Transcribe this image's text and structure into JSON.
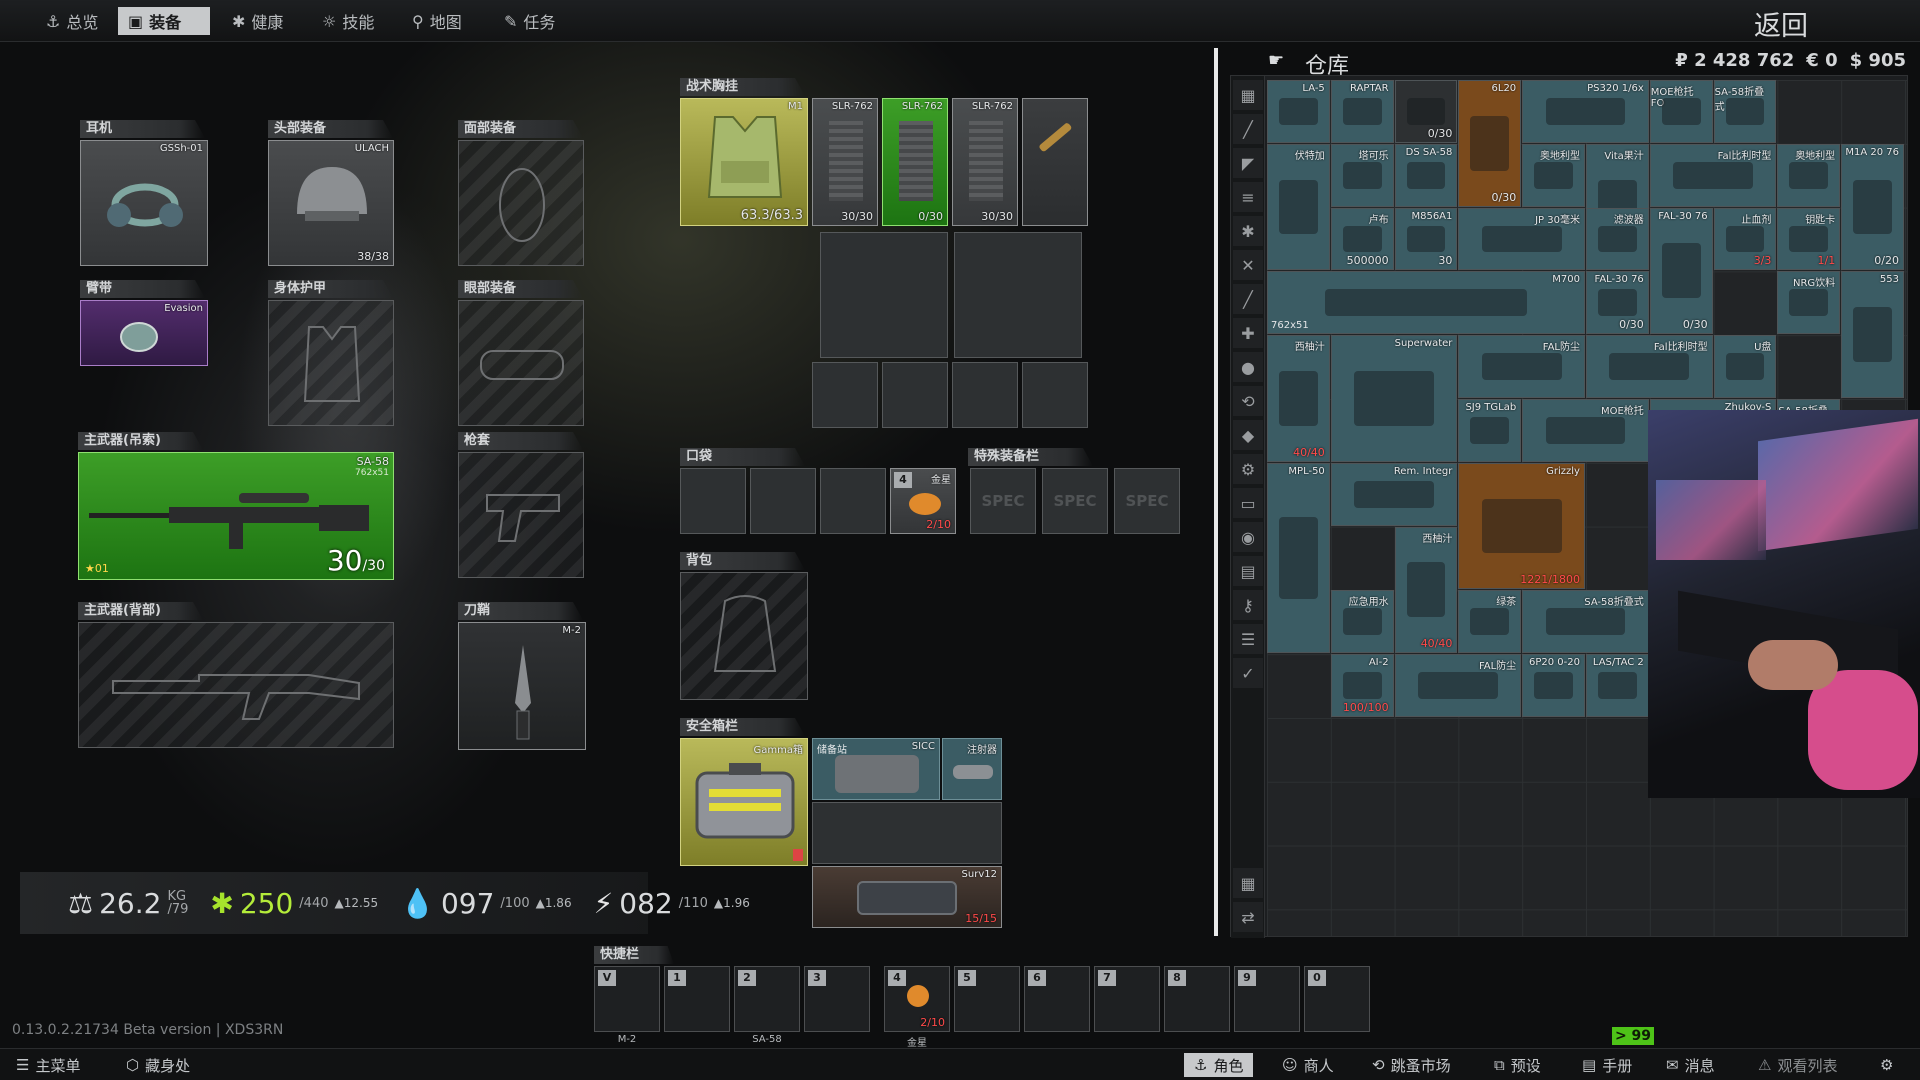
{
  "tabs": [
    {
      "label": "总览",
      "icon": "anchor-icon"
    },
    {
      "label": "装备",
      "icon": "vest-icon"
    },
    {
      "label": "健康",
      "icon": "health-icon"
    },
    {
      "label": "技能",
      "icon": "skills-icon"
    },
    {
      "label": "地图",
      "icon": "map-pin-icon"
    },
    {
      "label": "任务",
      "icon": "tasks-icon"
    }
  ],
  "back_label": "返回",
  "slots": {
    "earpiece": {
      "label": "耳机",
      "item": "GSSh-01"
    },
    "headwear": {
      "label": "头部装备",
      "item": "ULACH",
      "count": "38/38"
    },
    "face": {
      "label": "面部装备"
    },
    "armband": {
      "label": "臂带",
      "item": "Evasion"
    },
    "body_armor": {
      "label": "身体护甲"
    },
    "eyewear": {
      "label": "眼部装备"
    },
    "primary_sling": {
      "label": "主武器(吊索)",
      "item": "SA-58",
      "caliber": "762x51",
      "ammo": "30",
      "ammo_max": "/30",
      "level": "01"
    },
    "holster": {
      "label": "枪套"
    },
    "primary_back": {
      "label": "主武器(背部)"
    },
    "scabbard": {
      "label": "刀鞘",
      "item": "M-2"
    },
    "rig": {
      "label": "战术胸挂",
      "item": "M1",
      "durability": "63.3/63.3",
      "mags": [
        {
          "name": "SLR-762",
          "count": "30/30"
        },
        {
          "name": "SLR-762",
          "count": "0/30"
        },
        {
          "name": "SLR-762",
          "count": "30/30"
        }
      ]
    },
    "pockets": {
      "label": "口袋",
      "item": "金星",
      "item_count": "2/10",
      "key": "4"
    },
    "special": {
      "label": "特殊装备栏",
      "spec": [
        "SPEC",
        "SPEC",
        "SPEC"
      ]
    },
    "backpack": {
      "label": "背包"
    },
    "secure": {
      "label": "安全箱栏",
      "item": "Gamma箱",
      "contents": [
        {
          "name": "储备站"
        },
        {
          "name": "SICC"
        },
        {
          "name": "注射器"
        },
        {
          "name": "Surv12",
          "count": "15/15"
        }
      ]
    }
  },
  "stats": {
    "weight": "26.2",
    "weight_unit": "KG",
    "weight_max": "/79",
    "health": "250",
    "health_max": "/440",
    "health_rate": "▲12.55",
    "hydration": "097",
    "hydration_max": "/100",
    "hydration_rate": "▲1.86",
    "energy": "082",
    "energy_max": "/110",
    "energy_rate": "▲1.96"
  },
  "quick": {
    "label": "快捷栏",
    "slots": [
      {
        "key": "V",
        "label": "M-2"
      },
      {
        "key": "1",
        "label": ""
      },
      {
        "key": "2",
        "label": "SA-58"
      },
      {
        "key": "3",
        "label": ""
      },
      {
        "key": "4",
        "label": "金星",
        "count": "2/10"
      },
      {
        "key": "5",
        "label": ""
      },
      {
        "key": "6",
        "label": ""
      },
      {
        "key": "7",
        "label": ""
      },
      {
        "key": "8",
        "label": ""
      },
      {
        "key": "9",
        "label": ""
      },
      {
        "key": "0",
        "label": ""
      }
    ]
  },
  "stash": {
    "title": "仓库",
    "rub": "₽ 2 428 762",
    "eur": "€ 0",
    "usd": "$ 905",
    "items": [
      {
        "name": "LA-5",
        "color": "teal"
      },
      {
        "name": "RAPTAR",
        "color": "teal"
      },
      {
        "name": "",
        "count": "0/30",
        "color": "grey"
      },
      {
        "name": "6L20",
        "count": "0/30",
        "color": "orange"
      },
      {
        "name": "PS320 1/6x",
        "color": "teal"
      },
      {
        "name": "MOE枪托 FO",
        "color": "teal"
      },
      {
        "name": "SA-58折叠式",
        "color": "teal"
      },
      {
        "name": "伏特加",
        "color": "teal"
      },
      {
        "name": "塔可乐",
        "color": "teal"
      },
      {
        "name": "DS SA-58",
        "color": "teal"
      },
      {
        "name": "奥地利型",
        "color": "teal"
      },
      {
        "name": "Vita果汁",
        "count": "40/40",
        "color": "teal"
      },
      {
        "name": "Fal比利时型",
        "color": "teal"
      },
      {
        "name": "奥地利型",
        "color": "teal"
      },
      {
        "name": "M1A 20 76",
        "count": "0/20",
        "color": "teal"
      },
      {
        "name": "卢布",
        "count": "500000",
        "color": "teal"
      },
      {
        "name": "M856A1",
        "count": "30",
        "color": "teal"
      },
      {
        "name": "JP 30毫米",
        "color": "teal"
      },
      {
        "name": "FAL-30 76",
        "count": "0/30",
        "color": "teal"
      },
      {
        "name": "止血剂",
        "count": "3/3",
        "color": "teal"
      },
      {
        "name": "钥匙卡",
        "count": "1/1",
        "color": "teal"
      },
      {
        "name": "M700",
        "caliber": "762x51",
        "color": "teal"
      },
      {
        "name": "滤波器",
        "color": "teal"
      },
      {
        "name": "FAL-30 76",
        "count": "0/30",
        "color": "teal"
      },
      {
        "name": "NRG饮料",
        "color": "teal"
      },
      {
        "name": "西柚汁",
        "count": "40/40",
        "color": "teal"
      },
      {
        "name": "Superwater",
        "color": "teal"
      },
      {
        "name": "FAL防尘",
        "color": "teal"
      },
      {
        "name": "Fal比利时型",
        "color": "teal"
      },
      {
        "name": "U盘",
        "color": "teal"
      },
      {
        "name": "553",
        "color": "teal"
      },
      {
        "name": "SJ9 TGLab",
        "color": "teal"
      },
      {
        "name": "MOE枪托",
        "color": "teal"
      },
      {
        "name": "Zhukov-S",
        "color": "teal"
      },
      {
        "name": "SA-58折叠式",
        "color": "teal"
      },
      {
        "name": "MPL-50",
        "color": "teal"
      },
      {
        "name": "Rem. Integr",
        "color": "teal"
      },
      {
        "name": "Grizzly",
        "count": "1221/1800",
        "color": "orange"
      },
      {
        "name": "西柚汁",
        "count": "40/40",
        "color": "teal"
      },
      {
        "name": "应急用水",
        "color": "teal"
      },
      {
        "name": "绿茶",
        "color": "teal"
      },
      {
        "name": "SA-58折叠式",
        "color": "teal"
      },
      {
        "name": "AI-2",
        "count": "100/100",
        "color": "teal"
      },
      {
        "name": "FAL防尘",
        "color": "teal"
      },
      {
        "name": "6P20 0-20",
        "color": "teal"
      },
      {
        "name": "LAS/TAC 2",
        "color": "teal"
      }
    ]
  },
  "bottom": {
    "main_menu": "主菜单",
    "hideout": "藏身处",
    "character": "角色",
    "traders": "商人",
    "flea": "跳蚤市场",
    "presets": "预设",
    "handbook": "手册",
    "messages": "消息",
    "watchlist": "观看列表"
  },
  "version": "0.13.0.2.21734 Beta version | XDS3RN",
  "badge": "> 99"
}
